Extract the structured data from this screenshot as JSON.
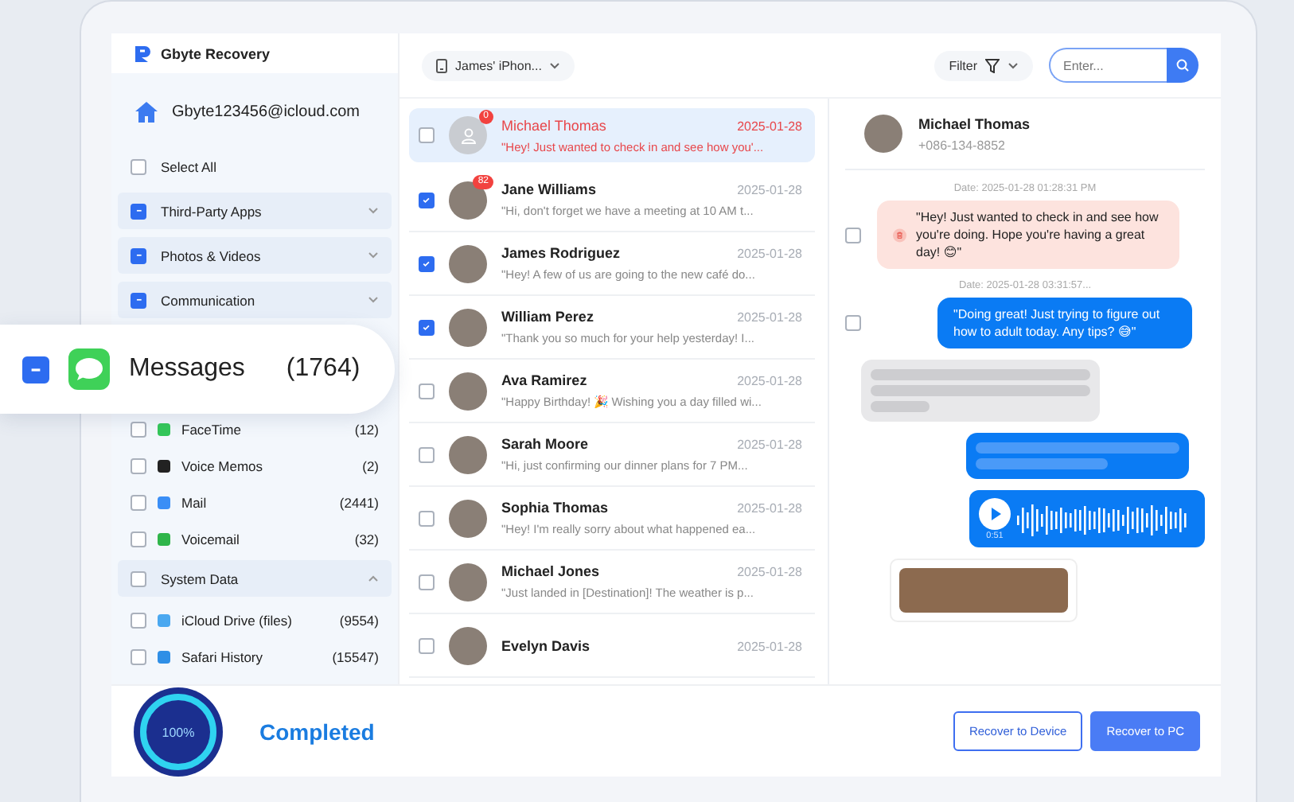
{
  "app": {
    "title": "Gbyte Recovery"
  },
  "account": {
    "email": "Gbyte123456@icloud.com"
  },
  "sidebar": {
    "select_all": {
      "label": "Select All",
      "checked": false
    },
    "items": [
      {
        "kind": "group",
        "label": "Third-Party Apps",
        "partial": true,
        "expanded": false
      },
      {
        "kind": "group",
        "label": "Photos & Videos",
        "partial": true,
        "expanded": false
      },
      {
        "kind": "group",
        "label": "Communication",
        "partial": true,
        "expanded": false
      },
      {
        "kind": "gap"
      },
      {
        "kind": "item",
        "label": "FaceTime",
        "count": "(12)",
        "checked": false,
        "color": "#34c759"
      },
      {
        "kind": "item",
        "label": "Voice Memos",
        "count": "(2)",
        "checked": false,
        "color": "#222222"
      },
      {
        "kind": "item",
        "label": "Mail",
        "count": "(2441)",
        "checked": false,
        "color": "#3a8ef6"
      },
      {
        "kind": "item",
        "label": "Voicemail",
        "count": "(32)",
        "checked": false,
        "color": "#2fb54a"
      },
      {
        "kind": "group",
        "label": "System Data",
        "partial": false,
        "expanded": true
      },
      {
        "kind": "item",
        "label": "iCloud Drive (files)",
        "count": "(9554)",
        "checked": false,
        "color": "#4aa8f0"
      },
      {
        "kind": "item",
        "label": "Safari History",
        "count": "(15547)",
        "checked": false,
        "color": "#2f8fe6"
      }
    ]
  },
  "highlight_card": {
    "label": "Messages",
    "count": "(1764)",
    "partial": true
  },
  "toolbar": {
    "device": "James' iPhon...",
    "filter": "Filter",
    "search": {
      "placeholder": "Enter..."
    }
  },
  "conversations": [
    {
      "name": "Michael Thomas",
      "date": "2025-01-28",
      "preview": "\"Hey! Just wanted to check in and see how you'...",
      "selected": true,
      "checked": false,
      "badge": "0",
      "has_photo": false
    },
    {
      "name": "Jane Williams",
      "date": "2025-01-28",
      "preview": "\"Hi, don't forget we have a meeting at 10 AM t...",
      "selected": false,
      "checked": true,
      "badge": "82",
      "has_photo": true
    },
    {
      "name": "James Rodriguez",
      "date": "2025-01-28",
      "preview": "\"Hey! A few of us are going to the new café do...",
      "selected": false,
      "checked": true,
      "has_photo": true
    },
    {
      "name": "William Perez",
      "date": "2025-01-28",
      "preview": "\"Thank you so much for your help yesterday! I...",
      "selected": false,
      "checked": true,
      "has_photo": true
    },
    {
      "name": "Ava Ramirez",
      "date": "2025-01-28",
      "preview": "\"Happy Birthday! 🎉 Wishing you a day filled wi...",
      "selected": false,
      "checked": false,
      "has_photo": true
    },
    {
      "name": "Sarah Moore",
      "date": "2025-01-28",
      "preview": "\"Hi, just confirming our dinner plans for 7 PM...",
      "selected": false,
      "checked": false,
      "has_photo": true
    },
    {
      "name": "Sophia Thomas",
      "date": "2025-01-28",
      "preview": "\"Hey! I'm really sorry about what happened ea...",
      "selected": false,
      "checked": false,
      "has_photo": true
    },
    {
      "name": "Michael Jones",
      "date": "2025-01-28",
      "preview": "\"Just landed in [Destination]! The weather is p...",
      "selected": false,
      "checked": false,
      "has_photo": true
    },
    {
      "name": "Evelyn Davis",
      "date": "2025-01-28",
      "selected": false,
      "checked": false,
      "has_photo": true
    }
  ],
  "chat": {
    "contact": {
      "name": "Michael Thomas",
      "phone": "+086-134-8852"
    },
    "messages": [
      {
        "kind": "deleted",
        "date": "Date: 2025-01-28  01:28:31 PM",
        "text": "\"Hey! Just wanted to check in and see how you're doing. Hope you're having a great day! 😊\"",
        "checked": false
      },
      {
        "kind": "sent",
        "date": "Date: 2025-01-28  03:31:57...",
        "text": "\"Doing great! Just trying to figure out how to adult today. Any tips? 😅\"",
        "checked": false
      },
      {
        "kind": "skeleton_in"
      },
      {
        "kind": "skeleton_out"
      },
      {
        "kind": "audio",
        "duration": "0:51"
      },
      {
        "kind": "image"
      }
    ]
  },
  "footer": {
    "progress": {
      "level": 1,
      "label": "100%"
    },
    "status": "Completed",
    "buttons": [
      {
        "label": "Recover to Device",
        "primary": false
      },
      {
        "label": "Recover to PC",
        "primary": true
      }
    ]
  }
}
